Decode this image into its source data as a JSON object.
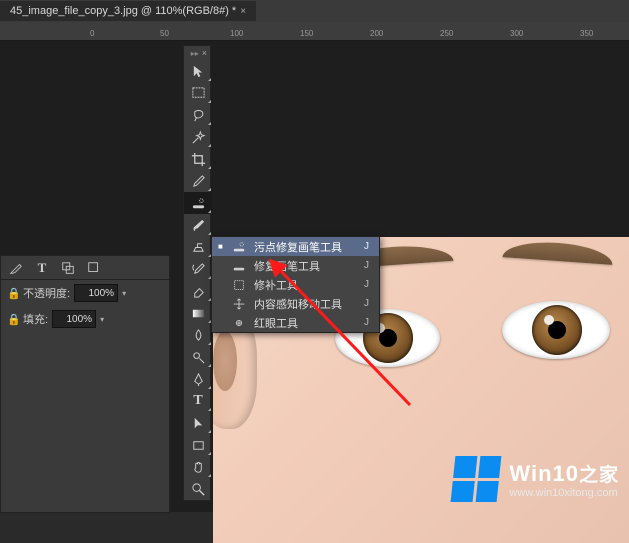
{
  "doc_tab": {
    "title": "45_image_file_copy_3.jpg @ 110%(RGB/8#) *",
    "close": "×"
  },
  "ruler": {
    "marks": [
      "0",
      "50",
      "100",
      "150",
      "200",
      "250",
      "300",
      "350"
    ]
  },
  "left_panel": {
    "opacity_label": "不透明度:",
    "opacity_value": "100%",
    "fill_label": "填充:",
    "fill_value": "100%"
  },
  "tools": {
    "move": "move-tool",
    "marquee": "rectangular-marquee",
    "lasso": "lasso-tool",
    "wand": "magic-wand",
    "crop": "crop-tool",
    "eyedrop": "eyedropper",
    "heal": "spot-healing-brush",
    "brush": "brush-tool",
    "stamp": "clone-stamp",
    "history": "history-brush",
    "eraser": "eraser-tool",
    "gradient": "gradient-tool",
    "blur": "blur-tool",
    "dodge": "dodge-tool",
    "pen": "pen-tool",
    "type": "type-tool",
    "path": "path-selection",
    "rect": "rectangle-tool",
    "hand": "hand-tool",
    "zoom": "zoom-tool"
  },
  "flyout": {
    "items": [
      {
        "label": "污点修复画笔工具",
        "key": "J",
        "selected": true,
        "icon": "spot-heal-icon"
      },
      {
        "label": "修复画笔工具",
        "key": "J",
        "selected": false,
        "icon": "healing-brush-icon"
      },
      {
        "label": "修补工具",
        "key": "J",
        "selected": false,
        "icon": "patch-icon"
      },
      {
        "label": "内容感知移动工具",
        "key": "J",
        "selected": false,
        "icon": "content-aware-move-icon"
      },
      {
        "label": "红眼工具",
        "key": "J",
        "selected": false,
        "icon": "red-eye-icon"
      }
    ]
  },
  "watermark": {
    "title_en": "Win10",
    "title_zh": "之家",
    "url": "www.win10xitong.com"
  },
  "type_glyph": "T"
}
